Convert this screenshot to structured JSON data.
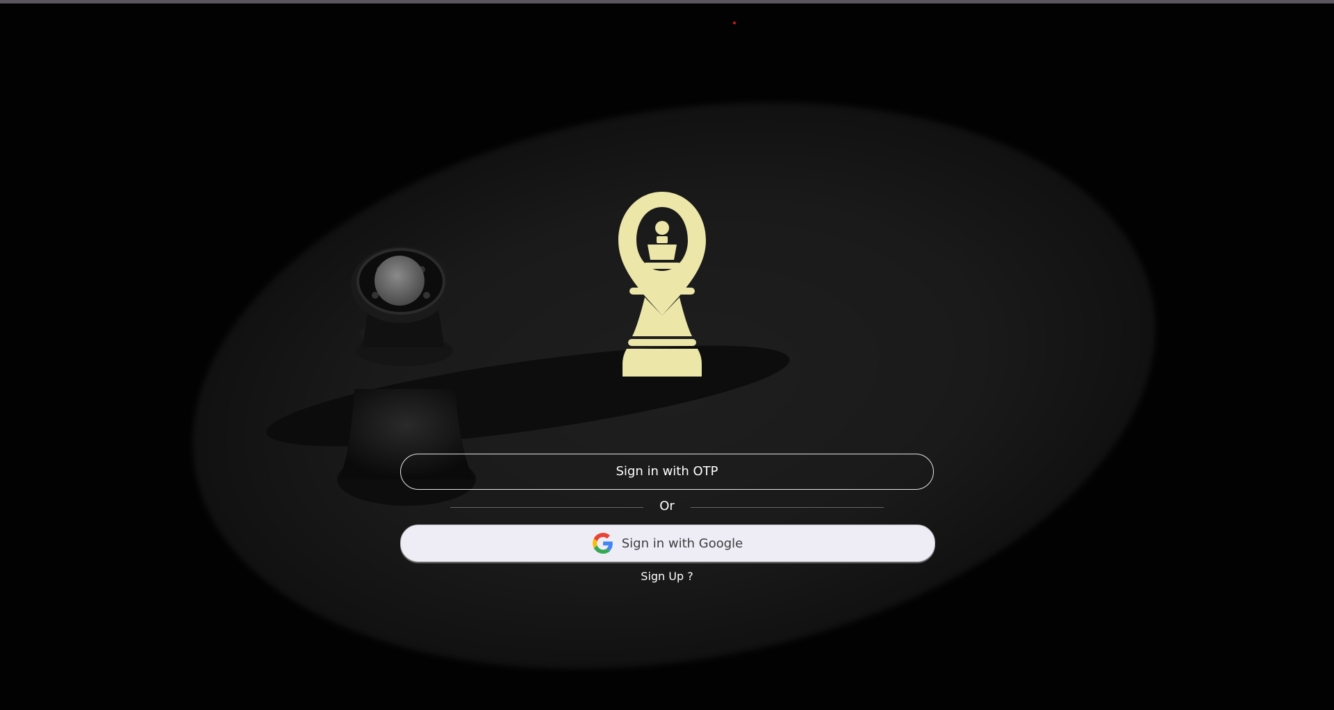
{
  "colors": {
    "logo": "#ece7a8",
    "background": "#020202",
    "google_button_bg": "#eeedf6",
    "button_border": "#e8e8e8"
  },
  "logo": {
    "icon": "chess-bishop-logo-icon"
  },
  "auth": {
    "otp_label": "Sign in with OTP",
    "divider_text": "Or",
    "google_label": "Sign in with Google",
    "google_icon": "google-g-icon",
    "signup_label": "Sign Up ?"
  }
}
